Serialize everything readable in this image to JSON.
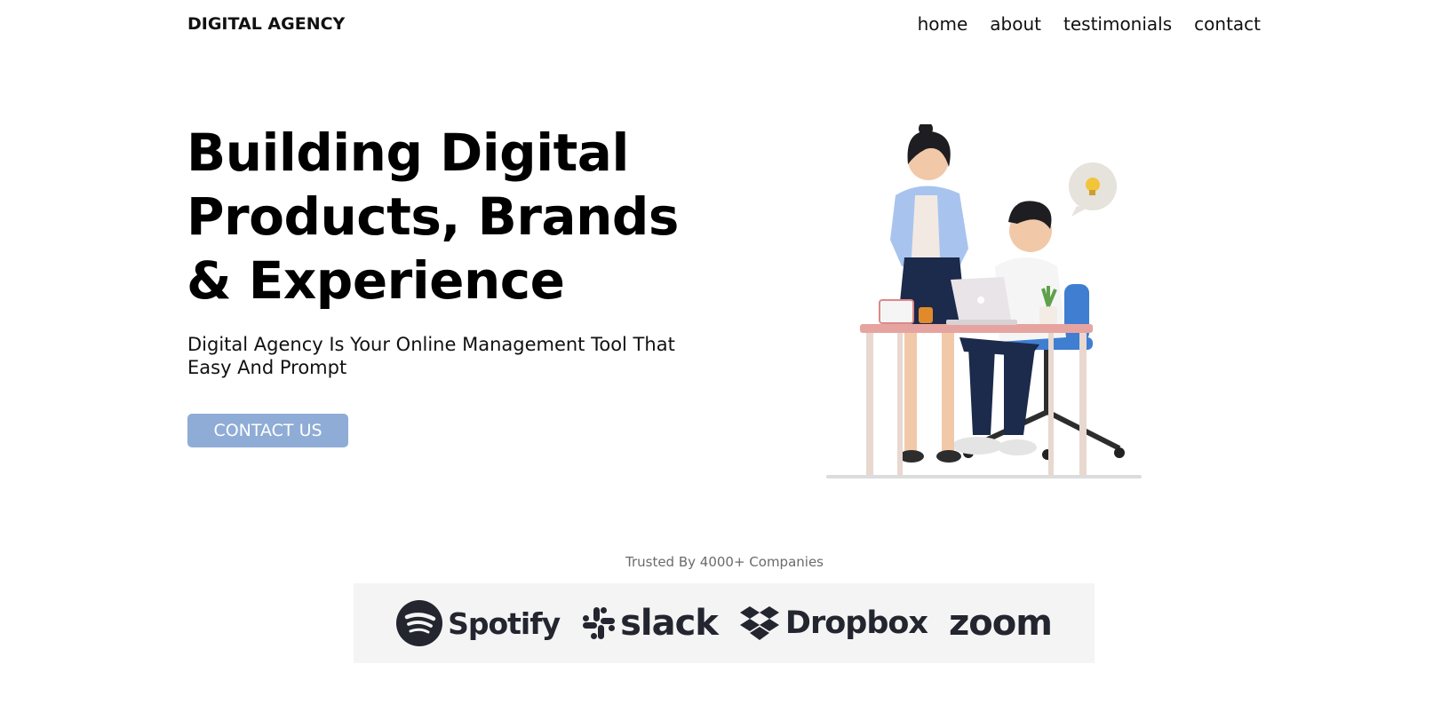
{
  "header": {
    "brand": "DIGITAL AGENCY",
    "nav": [
      {
        "label": "home"
      },
      {
        "label": "about"
      },
      {
        "label": "testimonials"
      },
      {
        "label": "contact"
      }
    ]
  },
  "hero": {
    "title_lines": [
      "Building Digital",
      "Products, Brands",
      "& Experience"
    ],
    "subtitle_lines": [
      "Digital Agency Is Your Online Management Tool That",
      "Easy And Prompt"
    ],
    "cta_label": "CONTACT US",
    "illustration_icon": "office-workers-illustration"
  },
  "trusted": {
    "text": "Trusted By 4000+ Companies",
    "logos": [
      {
        "name": "Spotify",
        "icon": "spotify-icon"
      },
      {
        "name": "slack",
        "icon": "slack-icon"
      },
      {
        "name": "Dropbox",
        "icon": "dropbox-icon"
      },
      {
        "name": "zoom",
        "icon": "zoom-logo"
      }
    ]
  },
  "colors": {
    "cta_bg": "#8eacd5",
    "logo_strip_bg": "#f4f4f5",
    "logo_color": "#23252f"
  }
}
